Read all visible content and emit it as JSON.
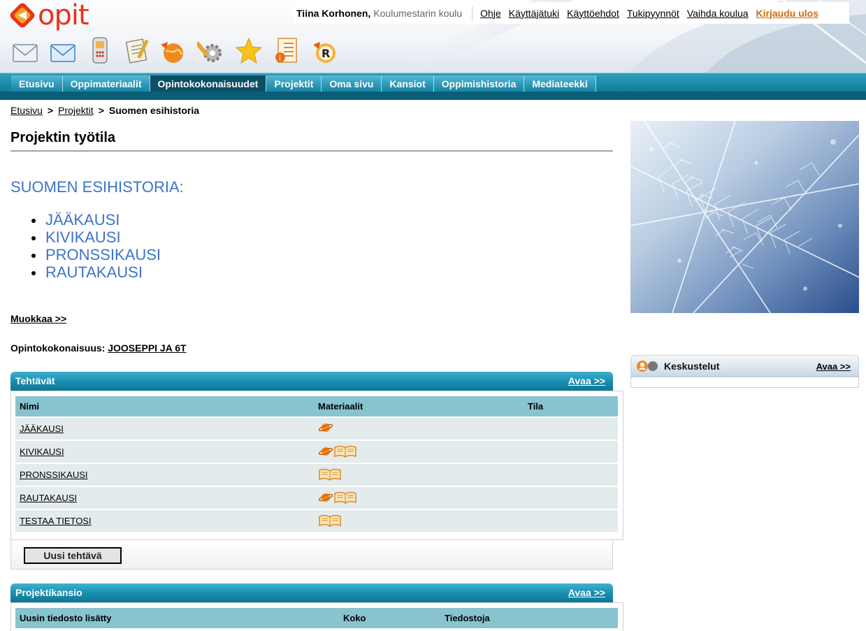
{
  "brand": {
    "name": "opit"
  },
  "user": {
    "name": "Tiina Korhonen,",
    "school": "Koulumestarin koulu",
    "links": [
      "Ohje",
      "Käyttäjätuki",
      "Käyttöehdot",
      "Tukipyynnöt",
      "Vaihda koulua"
    ],
    "logout": "Kirjaudu ulos"
  },
  "toolbar": {
    "icons": [
      "mail-read-icon",
      "mail-icon",
      "phone-icon",
      "notepad-icon",
      "web-globe-icon",
      "settings-tools-icon",
      "star-icon",
      "info-list-icon",
      "reader-r-icon"
    ]
  },
  "nav": {
    "tabs": [
      "Etusivu",
      "Oppimateriaalit",
      "Opintokokonaisuudet",
      "Projektit",
      "Oma sivu",
      "Kansiot",
      "Oppimishistoria",
      "Mediateekki"
    ],
    "active": "Opintokokonaisuudet"
  },
  "breadcrumb": {
    "items": [
      "Etusivu",
      "Projektit"
    ],
    "separator": ">",
    "current": "Suomen esihistoria"
  },
  "page": {
    "title": "Projektin työtila",
    "heading": "SUOMEN ESIHISTORIA:",
    "topics": [
      "JÄÄKAUSI",
      "KIVIKAUSI",
      "PRONSSIKAUSI",
      "RAUTAKAUSI"
    ],
    "edit_link": "Muokkaa >>",
    "course_label": "Opintokokonaisuus:",
    "course_value": "JOOSEPPI JA 6T"
  },
  "tasks": {
    "title": "Tehtävät",
    "open_link": "Avaa  >>",
    "columns": [
      "Nimi",
      "Materiaalit",
      "Tila"
    ],
    "rows": [
      {
        "name": "JÄÄKAUSI",
        "materials": [
          "web-material-icon"
        ]
      },
      {
        "name": "KIVIKAUSI",
        "materials": [
          "web-material-icon",
          "book-material-icon"
        ]
      },
      {
        "name": "PRONSSIKAUSI",
        "materials": [
          "book-material-icon"
        ]
      },
      {
        "name": "RAUTAKAUSI",
        "materials": [
          "web-material-icon",
          "book-material-icon"
        ]
      },
      {
        "name": "TESTAA TIETOSI",
        "materials": [
          "book-material-icon"
        ]
      }
    ],
    "new_button": "Uusi tehtävä"
  },
  "folder": {
    "title": "Projektikansio",
    "open_link": "Avaa  >>",
    "columns": [
      "Uusin tiedosto lisätty",
      "Koko",
      "Tiedostoja"
    ]
  },
  "discussions": {
    "title": "Keskustelut",
    "open_link": "Avaa  >>"
  },
  "colors": {
    "accent_blue": "#3d73cc",
    "logo_red": "#e8331c",
    "logout_orange": "#d06a12",
    "nav_teal": "#1787a6",
    "table_header": "#88c3d0"
  }
}
